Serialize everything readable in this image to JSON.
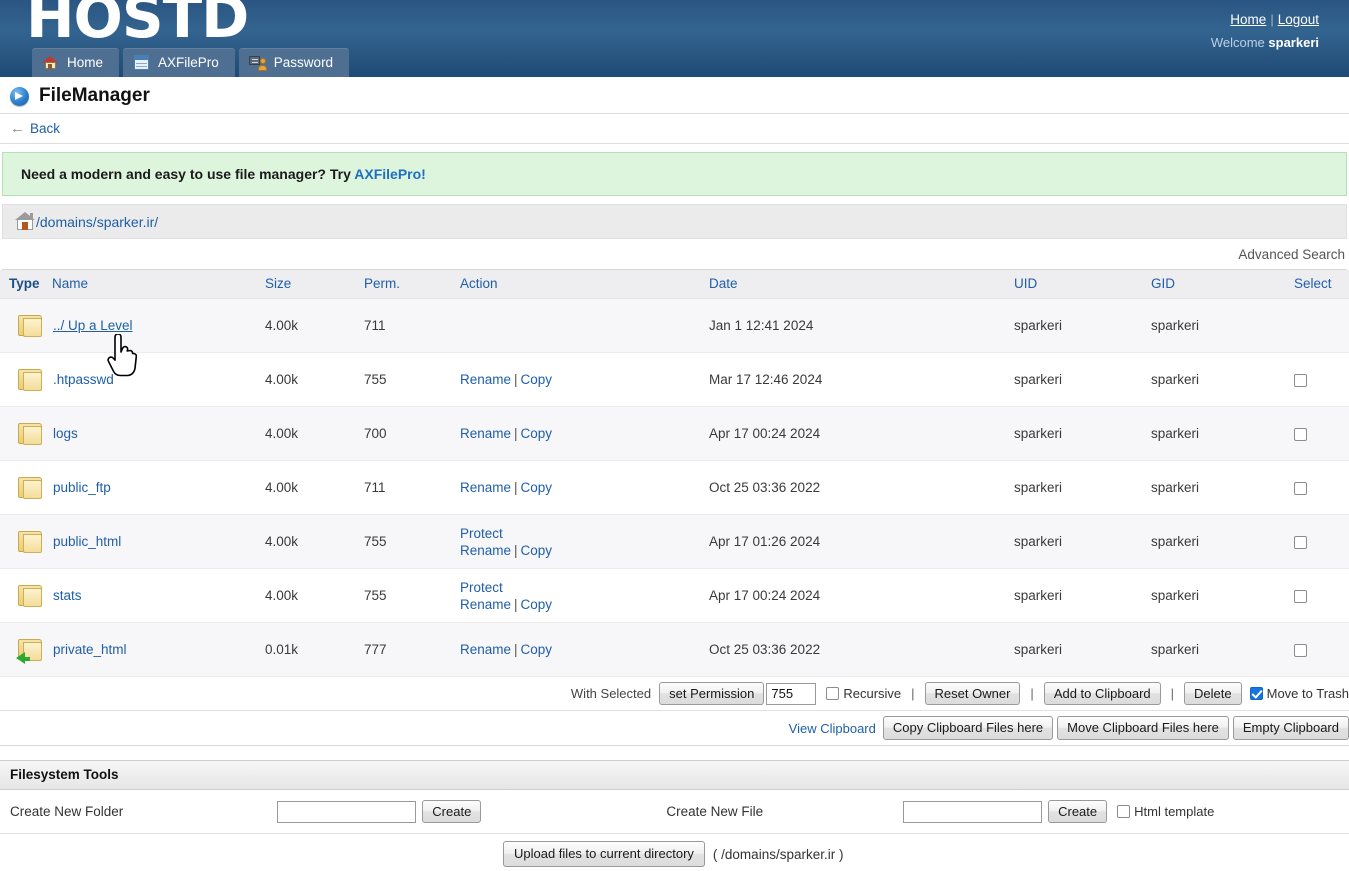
{
  "header": {
    "logo": "HOSTD",
    "links": {
      "home": "Home",
      "separator": "|",
      "logout": "Logout"
    },
    "welcome_prefix": "Welcome",
    "welcome_user": "sparkeri",
    "tabs": [
      {
        "label": "Home",
        "icon": "house-icon"
      },
      {
        "label": "AXFilePro",
        "icon": "document-icon"
      },
      {
        "label": "Password",
        "icon": "key-user-icon"
      }
    ]
  },
  "page": {
    "title": "FileManager",
    "back_label": "Back",
    "notice_text": "Need a modern and easy to use file manager? Try ",
    "notice_link": "AXFilePro!",
    "path": "/domains/sparker.ir/",
    "advanced_search": "Advanced Search"
  },
  "table": {
    "headers": {
      "type": "Type",
      "name": "Name",
      "size": "Size",
      "perm": "Perm.",
      "action": "Action",
      "date": "Date",
      "uid": "UID",
      "gid": "GID",
      "select": "Select"
    },
    "rows": [
      {
        "name": "../ Up a Level",
        "size": "4.00k",
        "perm": "711",
        "actions": [],
        "date": "Jan 1 12:41 2024",
        "uid": "sparkeri",
        "gid": "sparkeri",
        "selectable": false,
        "symlink": false,
        "uplevel": true
      },
      {
        "name": ".htpasswd",
        "size": "4.00k",
        "perm": "755",
        "actions": [
          "Rename",
          "Copy"
        ],
        "date": "Mar 17 12:46 2024",
        "uid": "sparkeri",
        "gid": "sparkeri",
        "selectable": true,
        "symlink": false,
        "uplevel": false
      },
      {
        "name": "logs",
        "size": "4.00k",
        "perm": "700",
        "actions": [
          "Rename",
          "Copy"
        ],
        "date": "Apr 17 00:24 2024",
        "uid": "sparkeri",
        "gid": "sparkeri",
        "selectable": true,
        "symlink": false,
        "uplevel": false
      },
      {
        "name": "public_ftp",
        "size": "4.00k",
        "perm": "711",
        "actions": [
          "Rename",
          "Copy"
        ],
        "date": "Oct 25 03:36 2022",
        "uid": "sparkeri",
        "gid": "sparkeri",
        "selectable": true,
        "symlink": false,
        "uplevel": false
      },
      {
        "name": "public_html",
        "size": "4.00k",
        "perm": "755",
        "protect": "Protect",
        "actions": [
          "Rename",
          "Copy"
        ],
        "date": "Apr 17 01:26 2024",
        "uid": "sparkeri",
        "gid": "sparkeri",
        "selectable": true,
        "symlink": false,
        "uplevel": false
      },
      {
        "name": "stats",
        "size": "4.00k",
        "perm": "755",
        "protect": "Protect",
        "actions": [
          "Rename",
          "Copy"
        ],
        "date": "Apr 17 00:24 2024",
        "uid": "sparkeri",
        "gid": "sparkeri",
        "selectable": true,
        "symlink": false,
        "uplevel": false
      },
      {
        "name": "private_html",
        "size": "0.01k",
        "perm": "777",
        "actions": [
          "Rename",
          "Copy"
        ],
        "date": "Oct 25 03:36 2022",
        "uid": "sparkeri",
        "gid": "sparkeri",
        "selectable": true,
        "symlink": true,
        "uplevel": false
      }
    ]
  },
  "selected_bar": {
    "with_selected": "With Selected",
    "set_permission": "set Permission",
    "permission_value": "755",
    "recursive": "Recursive",
    "recursive_checked": false,
    "reset_owner": "Reset Owner",
    "add_to_clipboard": "Add to Clipboard",
    "delete": "Delete",
    "move_to_trash": "Move to Trash",
    "move_to_trash_checked": true,
    "separator": "|"
  },
  "clipboard_bar": {
    "view_clipboard": "View Clipboard",
    "copy_here": "Copy Clipboard Files here",
    "move_here": "Move Clipboard Files here",
    "empty": "Empty Clipboard"
  },
  "filesystem_tools": {
    "title": "Filesystem Tools",
    "create_folder_label": "Create New Folder",
    "create_folder_value": "",
    "create_folder_button": "Create",
    "create_file_label": "Create New File",
    "create_file_value": "",
    "create_file_button": "Create",
    "html_template_label": "Html template",
    "html_template_checked": false,
    "upload_button": "Upload files to current directory",
    "upload_path": "( /domains/sparker.ir )"
  }
}
